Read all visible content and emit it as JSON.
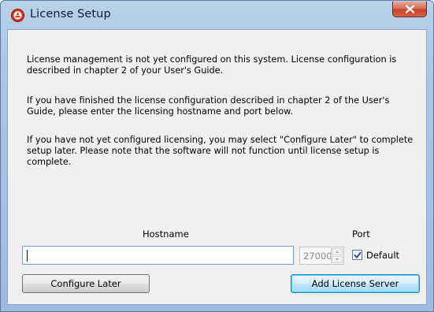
{
  "window": {
    "title": "License Setup",
    "app_icon": "logo-icon",
    "close_icon": "close-icon"
  },
  "message": {
    "paragraph1": "License management is not yet configured on this system.  License configuration is described in chapter 2 of your User's Guide.",
    "paragraph2": "If you have finished the license configuration described in chapter 2 of the User's Guide, please enter the licensing hostname and port below.",
    "paragraph3": "If you have not yet configured licensing, you may select \"Configure Later\" to complete setup later.  Please note that the software will not function until license setup is complete."
  },
  "form": {
    "hostname_label": "Hostname",
    "hostname_value": "",
    "port_label": "Port",
    "port_value": "27000",
    "default_label": "Default",
    "default_checked": true
  },
  "buttons": {
    "configure_later": "Configure Later",
    "add_license_server": "Add License Server"
  },
  "colors": {
    "accent_button_border": "#3c7fb1",
    "close_button": "#c4442b",
    "titlebar": "#b9d1ea"
  }
}
